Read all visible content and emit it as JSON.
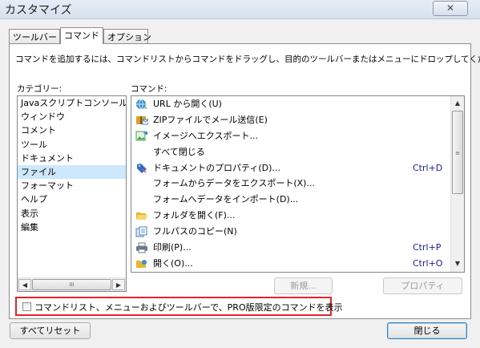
{
  "window": {
    "title": "カスタマイズ",
    "close_symbol": "✕"
  },
  "tabs": [
    {
      "label": "ツールバー",
      "active": false
    },
    {
      "label": "コマンド",
      "active": true
    },
    {
      "label": "オプション",
      "active": false
    }
  ],
  "instruction": "コマンドを追加するには、コマンドリストからコマンドをドラッグし、目的のツールバーまたはメニューにドロップしてください",
  "categories": {
    "label": "カテゴリー:",
    "items": [
      "Javaスクリプトコンソール",
      "ウィンドウ",
      "コメント",
      "ツール",
      "ドキュメント",
      "ファイル",
      "フォーマット",
      "ヘルプ",
      "表示",
      "編集"
    ],
    "selected": "ファイル",
    "scroll_thumb_glyph": "III"
  },
  "commands": {
    "label": "コマンド:",
    "items": [
      {
        "label": "URL から開く(U)",
        "shortcut": "",
        "icon": "globe-open-icon",
        "color": "#3a8fd0"
      },
      {
        "label": "ZIPファイルでメール送信(E)",
        "shortcut": "",
        "icon": "zip-mail-icon",
        "color": "#d9a12a"
      },
      {
        "label": "イメージへエクスポート...",
        "shortcut": "",
        "icon": "image-export-icon",
        "color": "#4aa34a"
      },
      {
        "label": "すべて閉じる",
        "shortcut": "",
        "icon": "",
        "color": ""
      },
      {
        "label": "ドキュメントのプロパティ(D)...",
        "shortcut": "Ctrl+D",
        "icon": "document-properties-icon",
        "color": "#2e6fc7"
      },
      {
        "label": "フォームからデータをエクスポート(X)...",
        "shortcut": "",
        "icon": "",
        "color": ""
      },
      {
        "label": "フォームへデータをインポート(D)...",
        "shortcut": "",
        "icon": "",
        "color": ""
      },
      {
        "label": "フォルダを開く(F)...",
        "shortcut": "",
        "icon": "folder-open-icon",
        "color": "#e8b632"
      },
      {
        "label": "フルパスのコピー(N)",
        "shortcut": "",
        "icon": "copy-path-icon",
        "color": "#4f7fbf"
      },
      {
        "label": "印刷(P)...",
        "shortcut": "Ctrl+P",
        "icon": "printer-icon",
        "color": "#6d7a88"
      },
      {
        "label": "開く(O)...",
        "shortcut": "Ctrl+O",
        "icon": "open-icon",
        "color": "#3a8fd0"
      }
    ],
    "scroll_thumb_glyph": "≡"
  },
  "buttons": {
    "new": "新規...",
    "properties": "プロパティ",
    "reset_all": "すべてリセット",
    "close": "閉じる"
  },
  "pro_option": {
    "label": "コマンドリスト、メニューおよびツールバーで、PRO版限定のコマンドを表示",
    "checked": false
  }
}
